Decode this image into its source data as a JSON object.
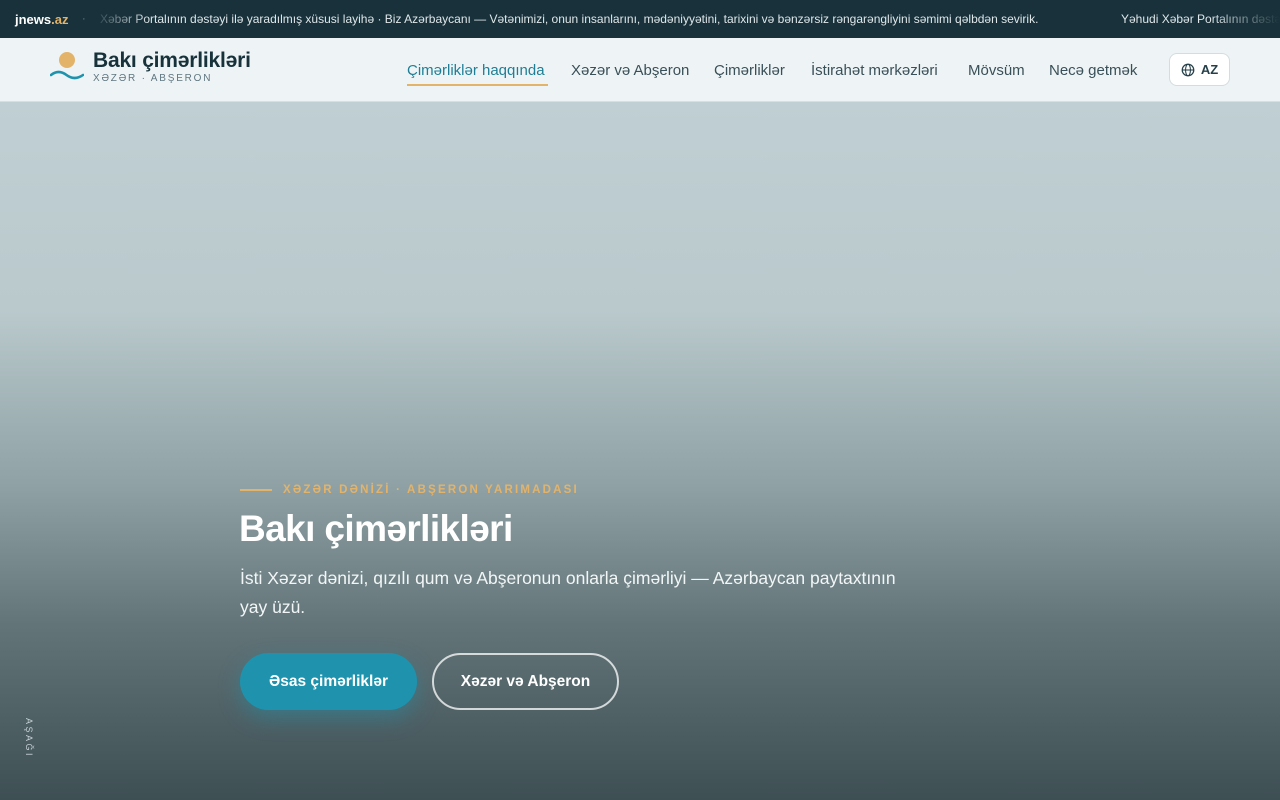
{
  "ticker": {
    "brand_name": "jnews",
    "brand_tld": ".az",
    "separator": "·",
    "message_1": "Xəbər Portalının dəstəyi ilə yaradılmış xüsusi layihə · Biz Azərbaycanı — Vətənimizi, onun insanlarını, mədəniyyətini, tarixini və bənzərsiz rəngarəngliyini səmimi qəlbdən sevirik.",
    "message_2": "Yəhudi Xəbər Portalının dəstəyi"
  },
  "header": {
    "logo_title": "Bakı çimərlikləri",
    "logo_subtitle": "XƏZƏR · ABŞERON",
    "nav": [
      {
        "label": "Çimərliklər haqqında",
        "active": true
      },
      {
        "label": "Xəzər və Abşeron",
        "active": false
      },
      {
        "label": "Çimərliklər",
        "active": false
      },
      {
        "label": "İstirahət mərkəzləri",
        "active": false
      },
      {
        "label": "Mövsüm",
        "active": false
      },
      {
        "label": "Necə getmək",
        "active": false
      }
    ],
    "language": "AZ"
  },
  "hero": {
    "kicker": "XƏZƏR DƏNİZİ · ABŞERON YARIMADASI",
    "title": "Bakı çimərlikləri",
    "description": "İsti Xəzər dənizi, qızılı qum və Abşeronun onlarla çimərliyi — Azərbaycan paytaxtının yay üzü.",
    "primary_button": "Əsas çimərliklər",
    "secondary_button": "Xəzər və Abşeron",
    "scroll_hint": "AŞAĞI"
  },
  "colors": {
    "accent": "#1f93ad",
    "gold": "#e3b36a",
    "dark": "#17323b"
  },
  "icons": {
    "logo": "sun-wave-icon",
    "language": "globe-icon"
  }
}
